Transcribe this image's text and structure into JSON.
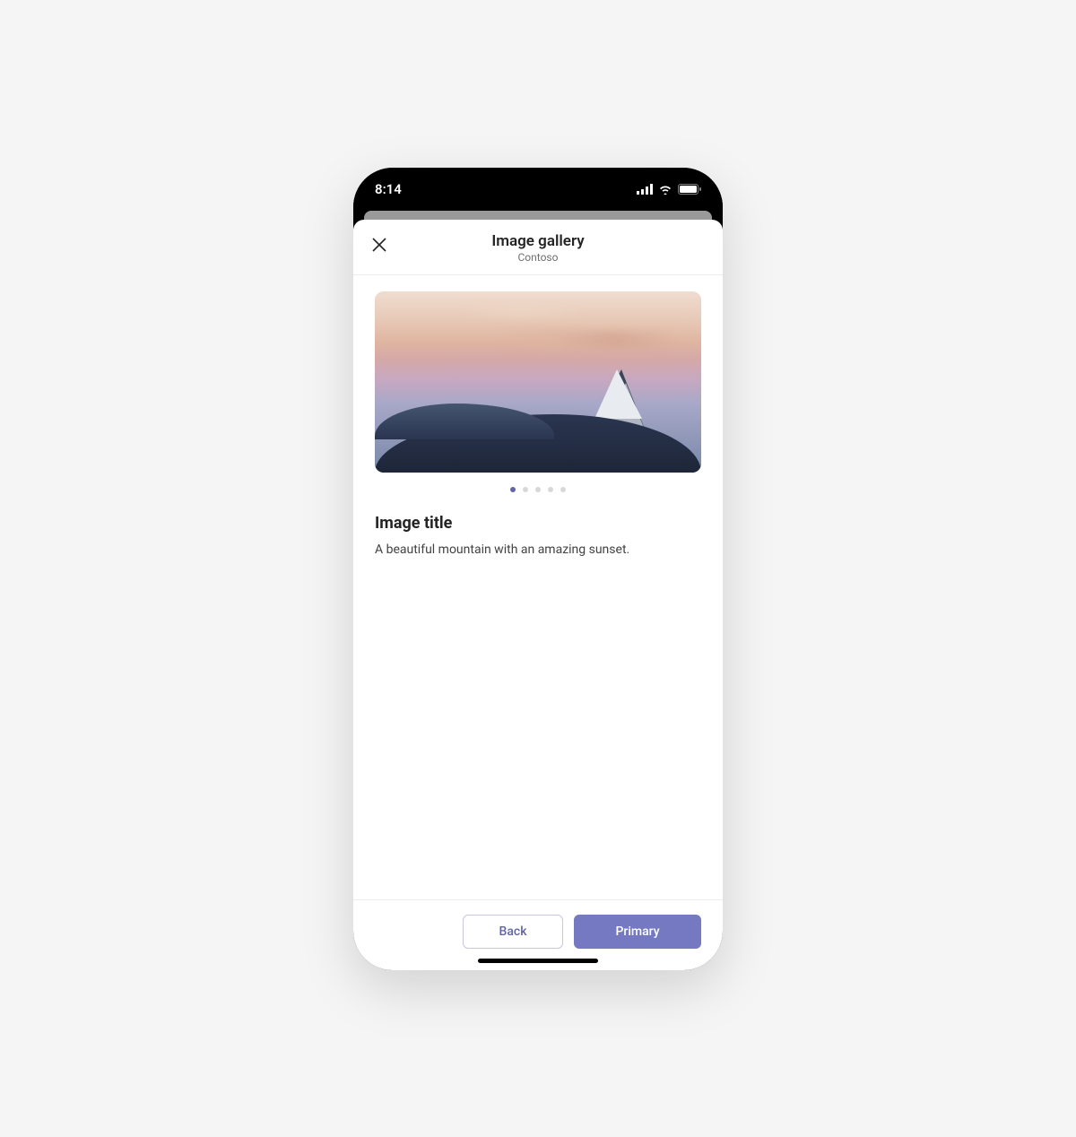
{
  "status_bar": {
    "time": "8:14"
  },
  "header": {
    "title": "Image gallery",
    "subtitle": "Contoso"
  },
  "content": {
    "title": "Image title",
    "description": "A beautiful mountain with an amazing sunset."
  },
  "pagination": {
    "count": 5,
    "active_index": 0
  },
  "footer": {
    "secondary_label": "Back",
    "primary_label": "Primary"
  },
  "colors": {
    "accent": "#6264a7",
    "primary_button": "#7479c2"
  }
}
